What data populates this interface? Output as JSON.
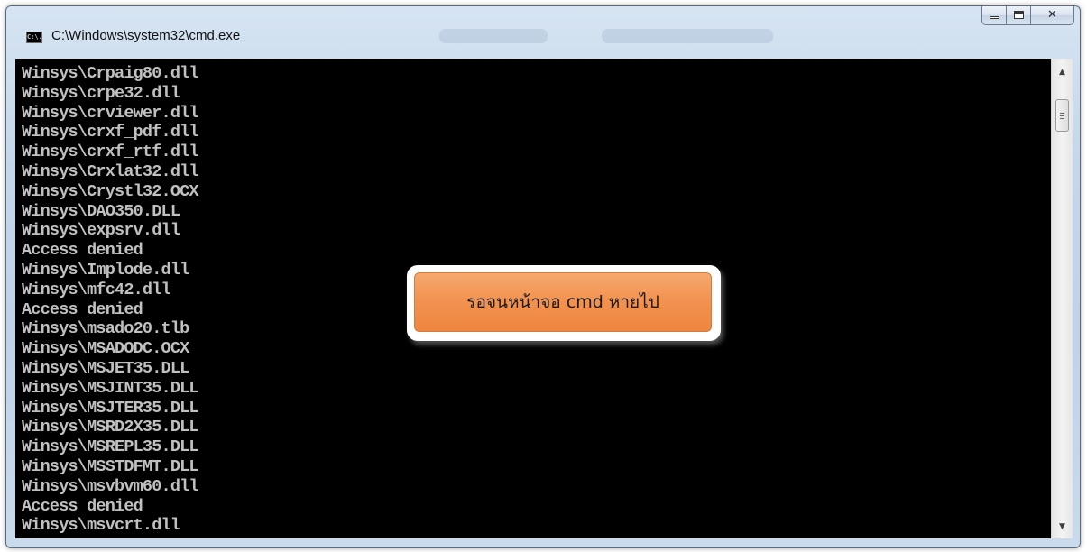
{
  "window": {
    "title": "C:\\Windows\\system32\\cmd.exe",
    "icon": "cmd-console-icon",
    "icon_text": "C:\\.",
    "buttons": {
      "minimize_icon": "minimize-icon",
      "maximize_icon": "maximize-icon",
      "close_icon": "close-icon"
    }
  },
  "console": {
    "background": "#000000",
    "text_color": "#c0c0c0",
    "lines": [
      "Winsys\\Crpaig80.dll",
      "Winsys\\crpe32.dll",
      "Winsys\\crviewer.dll",
      "Winsys\\crxf_pdf.dll",
      "Winsys\\crxf_rtf.dll",
      "Winsys\\Crxlat32.dll",
      "Winsys\\Crystl32.OCX",
      "Winsys\\DAO350.DLL",
      "Winsys\\expsrv.dll",
      "Access denied",
      "Winsys\\Implode.dll",
      "Winsys\\mfc42.dll",
      "Access denied",
      "Winsys\\msado20.tlb",
      "Winsys\\MSADODC.OCX",
      "Winsys\\MSJET35.DLL",
      "Winsys\\MSJINT35.DLL",
      "Winsys\\MSJTER35.DLL",
      "Winsys\\MSRD2X35.DLL",
      "Winsys\\MSREPL35.DLL",
      "Winsys\\MSSTDFMT.DLL",
      "Winsys\\msvbvm60.dll",
      "Access denied",
      "Winsys\\msvcrt.dll"
    ]
  },
  "scrollbar": {
    "up_icon": "scroll-up-arrow-icon",
    "down_icon": "scroll-down-arrow-icon"
  },
  "callout": {
    "text": "รอจนหน้าจอ cmd หายไป",
    "fill_color": "#f2914f"
  }
}
